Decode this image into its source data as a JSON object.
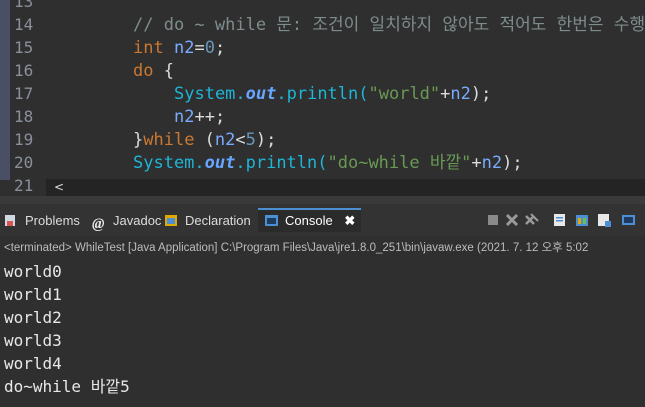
{
  "editor": {
    "lines": [
      {
        "num": "13",
        "tokens": []
      },
      {
        "num": "14",
        "tokens": [
          {
            "c": "cm",
            "t": "// do ~ while 문: 조건이 일치하지 않아도 적어도 한번은 수행"
          }
        ]
      },
      {
        "num": "15",
        "tokens": [
          {
            "c": "kw",
            "t": "int "
          },
          {
            "c": "var",
            "t": "n2"
          },
          {
            "c": "pl",
            "t": "="
          },
          {
            "c": "num",
            "t": "0"
          },
          {
            "c": "pl",
            "t": ";"
          }
        ]
      },
      {
        "num": "16",
        "tokens": [
          {
            "c": "kw",
            "t": "do "
          },
          {
            "c": "pl",
            "t": "{"
          }
        ]
      },
      {
        "num": "17",
        "indent": 1,
        "tokens": [
          {
            "c": "sys",
            "t": "System."
          },
          {
            "c": "out",
            "t": "out"
          },
          {
            "c": "sys",
            "t": ".println("
          },
          {
            "c": "str",
            "t": "\"world\""
          },
          {
            "c": "pl",
            "t": "+"
          },
          {
            "c": "var",
            "t": "n2"
          },
          {
            "c": "pl",
            "t": ");"
          }
        ]
      },
      {
        "num": "18",
        "indent": 1,
        "tokens": [
          {
            "c": "var",
            "t": "n2"
          },
          {
            "c": "pl",
            "t": "++;"
          }
        ]
      },
      {
        "num": "19",
        "tokens": [
          {
            "c": "pl",
            "t": "}"
          },
          {
            "c": "kw",
            "t": "while "
          },
          {
            "c": "pl",
            "t": "("
          },
          {
            "c": "var",
            "t": "n2"
          },
          {
            "c": "pl",
            "t": "<"
          },
          {
            "c": "num",
            "t": "5"
          },
          {
            "c": "pl",
            "t": ");"
          }
        ]
      },
      {
        "num": "20",
        "tokens": [
          {
            "c": "sys",
            "t": "System."
          },
          {
            "c": "out",
            "t": "out"
          },
          {
            "c": "sys",
            "t": ".println("
          },
          {
            "c": "str",
            "t": "\"do~while 바깥\""
          },
          {
            "c": "pl",
            "t": "+"
          },
          {
            "c": "var",
            "t": "n2"
          },
          {
            "c": "pl",
            "t": ");"
          }
        ]
      },
      {
        "num": "21",
        "tokens": []
      }
    ],
    "scroll_left": "<"
  },
  "tabs": [
    {
      "label": "Problems",
      "icon": "problems-icon",
      "color": "#d9534f"
    },
    {
      "label": "Javadoc",
      "icon": "javadoc-icon",
      "color": "#dcdcdc"
    },
    {
      "label": "Declaration",
      "icon": "declaration-icon",
      "color": "#e0a800"
    },
    {
      "label": "Console",
      "icon": "console-icon",
      "color": "#4d8fd3",
      "active": true
    }
  ],
  "console_close": "✖",
  "status": "<terminated> WhileTest [Java Application] C:\\Program Files\\Java\\jre1.8.0_251\\bin\\javaw.exe  (2021. 7. 12 오후 5:02",
  "output": [
    "world0",
    "world1",
    "world2",
    "world3",
    "world4",
    "do~while 바깥5"
  ],
  "colors": {
    "accent": "#4d8fd3",
    "background": "#2f2f2f"
  }
}
